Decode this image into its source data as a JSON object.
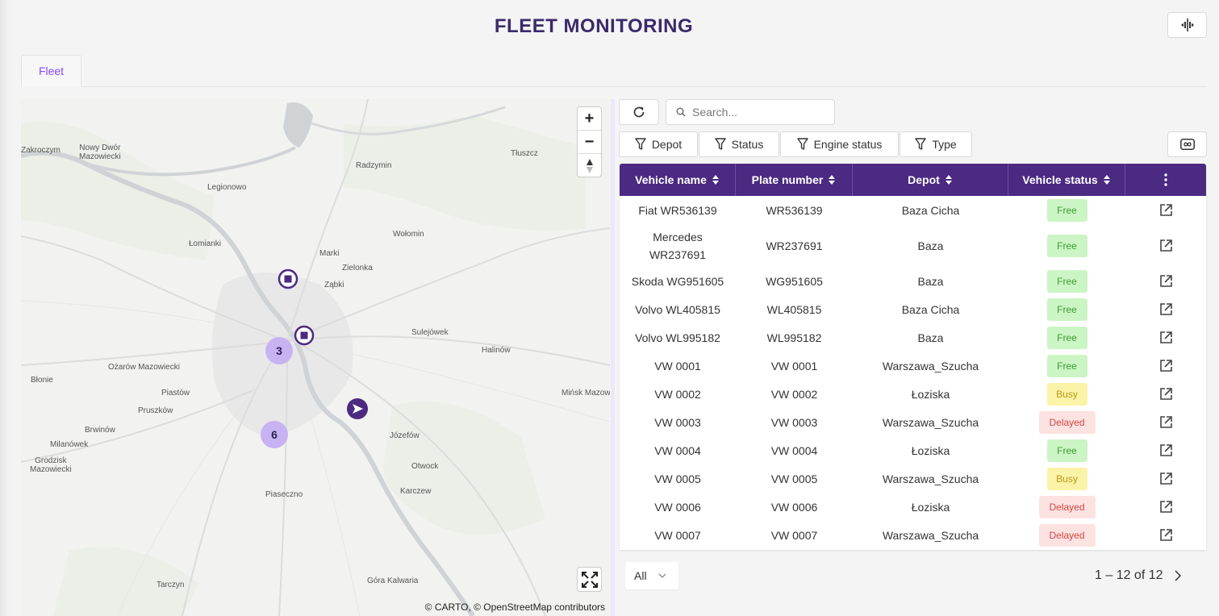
{
  "page": {
    "title": "FLEET MONITORING"
  },
  "header": {
    "split_icon": "column-split-icon"
  },
  "tabs": [
    {
      "label": "Fleet",
      "active": true
    }
  ],
  "map": {
    "zoom_in": "+",
    "zoom_out": "−",
    "reset_north": "compass-icon",
    "fullscreen": "fullscreen-icon",
    "attribution": "© CARTO, © OpenStreetMap contributors",
    "places": [
      "Zakroczym",
      "Nowy Dwór\nMazowiecki",
      "Legionowo",
      "Radzymin",
      "Tłuszcz",
      "Łomianki",
      "Marki",
      "Zielonka",
      "Ząbki",
      "Wołomin",
      "Sulejówek",
      "Halinów",
      "Ożarów Mazowiecki",
      "Błonie",
      "Piastów",
      "Pruszków",
      "Mińsk Mazow",
      "Brwinów",
      "Milanówek",
      "Grodzisk\nMazowiecki",
      "Józefów",
      "Otwock",
      "Karczew",
      "Piaseczno",
      "Tarczyn",
      "Góra Kalwaria"
    ],
    "clusters": [
      {
        "count": "3"
      },
      {
        "count": "6"
      }
    ],
    "markers": [
      "depot-marker",
      "depot-marker",
      "vehicle-marker"
    ],
    "colors": {
      "accent": "#4b2a82",
      "cluster": "#c7b3f2"
    }
  },
  "toolbar": {
    "refresh_icon": "refresh-icon",
    "search_placeholder": "Search...",
    "filters": [
      "Depot",
      "Status",
      "Engine status",
      "Type"
    ],
    "infinity_icon": "infinity-icon"
  },
  "table": {
    "columns": [
      "Vehicle name",
      "Plate number",
      "Depot",
      "Vehicle status"
    ],
    "rows": [
      {
        "name": "Fiat WR536139",
        "plate": "WR536139",
        "depot": "Baza Cicha",
        "status": "Free"
      },
      {
        "name": "Mercedes WR237691",
        "plate": "WR237691",
        "depot": "Baza",
        "status": "Free"
      },
      {
        "name": "Skoda WG951605",
        "plate": "WG951605",
        "depot": "Baza",
        "status": "Free"
      },
      {
        "name": "Volvo WL405815",
        "plate": "WL405815",
        "depot": "Baza Cicha",
        "status": "Free"
      },
      {
        "name": "Volvo WL995182",
        "plate": "WL995182",
        "depot": "Baza",
        "status": "Free"
      },
      {
        "name": "VW 0001",
        "plate": "VW 0001",
        "depot": "Warszawa_Szucha",
        "status": "Free"
      },
      {
        "name": "VW 0002",
        "plate": "VW 0002",
        "depot": "Łoziska",
        "status": "Busy"
      },
      {
        "name": "VW 0003",
        "plate": "VW 0003",
        "depot": "Warszawa_Szucha",
        "status": "Delayed"
      },
      {
        "name": "VW 0004",
        "plate": "VW 0004",
        "depot": "Łoziska",
        "status": "Free"
      },
      {
        "name": "VW 0005",
        "plate": "VW 0005",
        "depot": "Warszawa_Szucha",
        "status": "Busy"
      },
      {
        "name": "VW 0006",
        "plate": "VW 0006",
        "depot": "Łoziska",
        "status": "Delayed"
      },
      {
        "name": "VW 0007",
        "plate": "VW 0007",
        "depot": "Warszawa_Szucha",
        "status": "Delayed"
      }
    ]
  },
  "pagination": {
    "page_size": "All",
    "range": "1 – 12 of 12"
  }
}
